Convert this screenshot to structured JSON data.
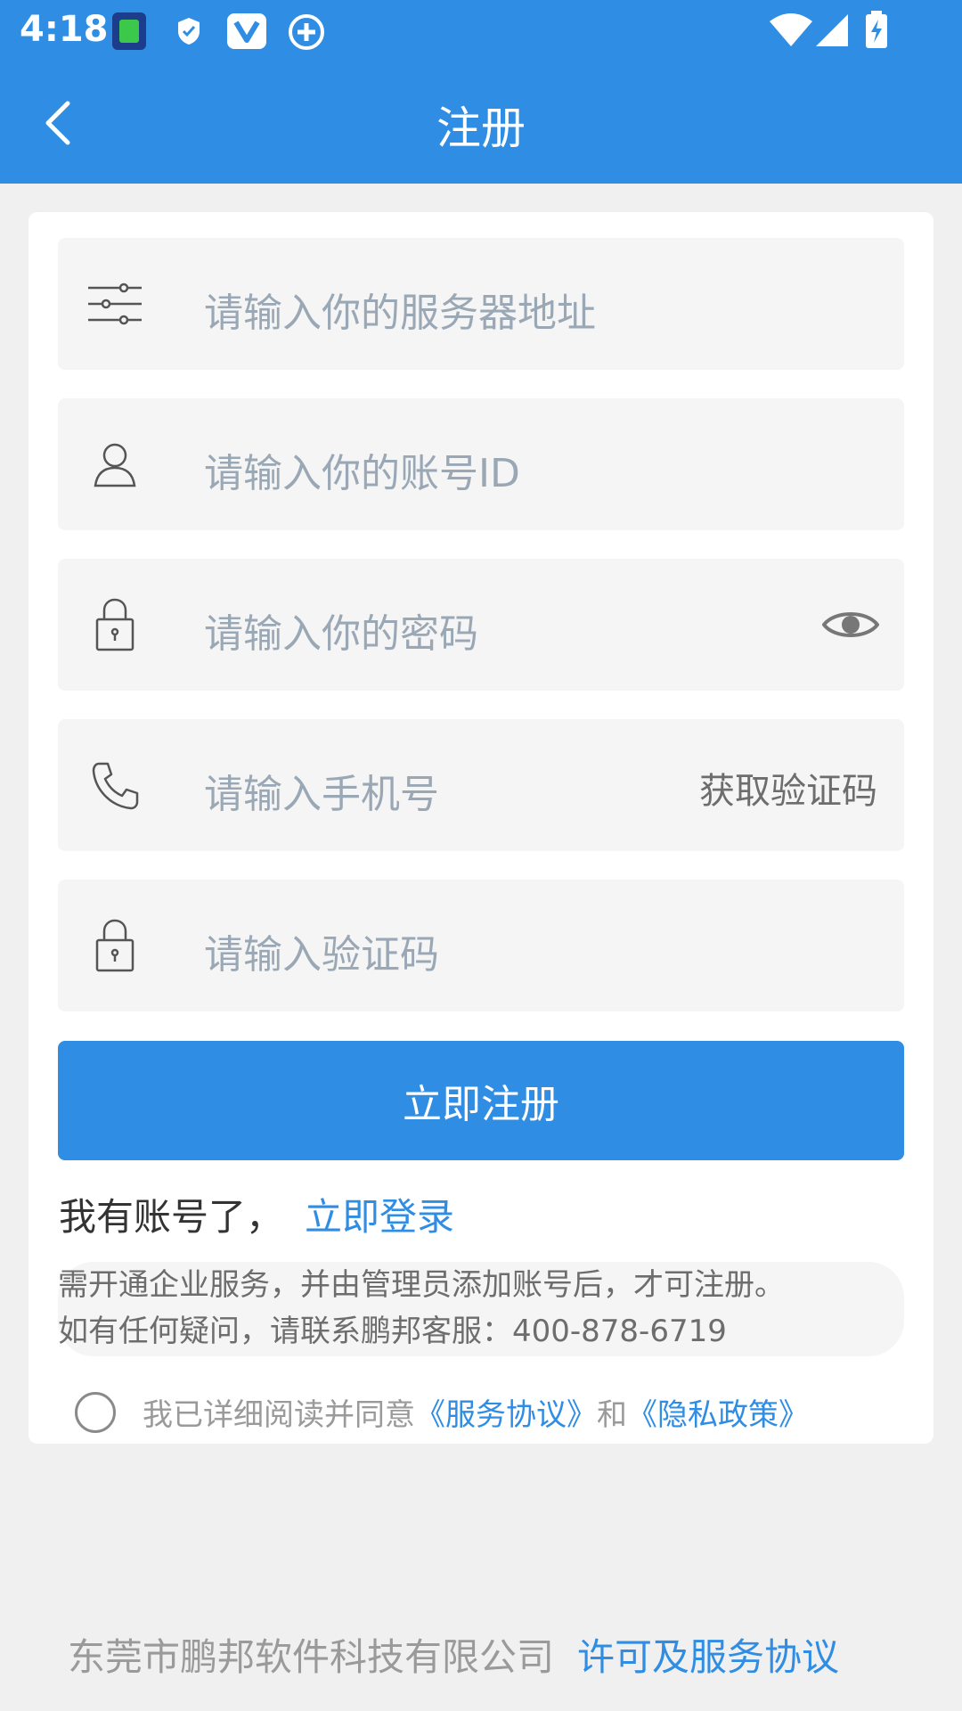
{
  "status_bar": {
    "time": "4:18"
  },
  "header": {
    "title": "注册"
  },
  "form": {
    "server_placeholder": "请输入你的服务器地址",
    "account_placeholder": "请输入你的账号ID",
    "password_placeholder": "请输入你的密码",
    "phone_placeholder": "请输入手机号",
    "get_code_label": "获取验证码",
    "code_placeholder": "请输入验证码",
    "register_label": "立即注册"
  },
  "login_prompt": {
    "text": "我有账号了，",
    "link": "立即登录"
  },
  "notice": {
    "line1": "需开通企业服务，并由管理员添加账号后，才可注册。",
    "line2": "如有任何疑问，请联系鹏邦客服：400-878-6719"
  },
  "agreement": {
    "prefix": "我已详细阅读并同意",
    "service": "《服务协议》",
    "and": "和",
    "privacy": "《隐私政策》"
  },
  "footer": {
    "company": "东莞市鹏邦软件科技有限公司",
    "license_link": "许可及服务协议"
  },
  "colors": {
    "primary": "#2f8de4",
    "field_bg": "#f5f5f5",
    "placeholder": "#9aa7b5"
  }
}
